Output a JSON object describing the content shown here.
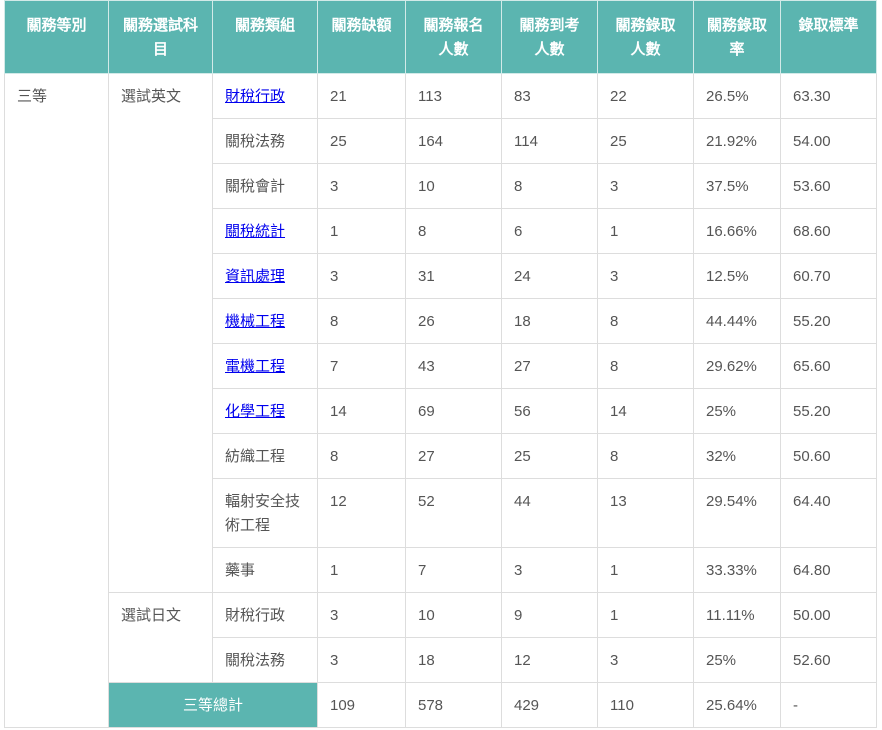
{
  "colors": {
    "header_bg": "#5bb5b0",
    "header_text": "#ffffff",
    "body_text": "#555555",
    "link": "#0000ee",
    "border": "#dddddd"
  },
  "table": {
    "headers": [
      "關務等別",
      "關務選試科目",
      "關務類組",
      "關務缺額",
      "關務報名人數",
      "關務到考人數",
      "關務錄取人數",
      "關務錄取率",
      "錄取標準"
    ],
    "level": "三等",
    "groups": [
      {
        "subject": "選試英文",
        "rows": [
          {
            "category": "財稅行政",
            "is_link": true,
            "vacancies": "21",
            "applicants": "113",
            "examinees": "83",
            "admitted": "22",
            "rate": "26.5%",
            "cutoff": "63.30"
          },
          {
            "category": "關稅法務",
            "is_link": false,
            "vacancies": "25",
            "applicants": "164",
            "examinees": "114",
            "admitted": "25",
            "rate": "21.92%",
            "cutoff": "54.00"
          },
          {
            "category": "關稅會計",
            "is_link": false,
            "vacancies": "3",
            "applicants": "10",
            "examinees": "8",
            "admitted": "3",
            "rate": "37.5%",
            "cutoff": "53.60"
          },
          {
            "category": "關稅統計",
            "is_link": true,
            "vacancies": "1",
            "applicants": "8",
            "examinees": "6",
            "admitted": "1",
            "rate": "16.66%",
            "cutoff": "68.60"
          },
          {
            "category": "資訊處理",
            "is_link": true,
            "vacancies": "3",
            "applicants": "31",
            "examinees": "24",
            "admitted": "3",
            "rate": "12.5%",
            "cutoff": "60.70"
          },
          {
            "category": "機械工程",
            "is_link": true,
            "vacancies": "8",
            "applicants": "26",
            "examinees": "18",
            "admitted": "8",
            "rate": "44.44%",
            "cutoff": "55.20"
          },
          {
            "category": "電機工程",
            "is_link": true,
            "vacancies": "7",
            "applicants": "43",
            "examinees": "27",
            "admitted": "8",
            "rate": "29.62%",
            "cutoff": "65.60"
          },
          {
            "category": "化學工程",
            "is_link": true,
            "vacancies": "14",
            "applicants": "69",
            "examinees": "56",
            "admitted": "14",
            "rate": "25%",
            "cutoff": "55.20"
          },
          {
            "category": "紡織工程",
            "is_link": false,
            "vacancies": "8",
            "applicants": "27",
            "examinees": "25",
            "admitted": "8",
            "rate": "32%",
            "cutoff": "50.60"
          },
          {
            "category": "輻射安全技術工程",
            "is_link": false,
            "vacancies": "12",
            "applicants": "52",
            "examinees": "44",
            "admitted": "13",
            "rate": "29.54%",
            "cutoff": "64.40"
          },
          {
            "category": "藥事",
            "is_link": false,
            "vacancies": "1",
            "applicants": "7",
            "examinees": "3",
            "admitted": "1",
            "rate": "33.33%",
            "cutoff": "64.80"
          }
        ]
      },
      {
        "subject": "選試日文",
        "rows": [
          {
            "category": "財稅行政",
            "is_link": false,
            "vacancies": "3",
            "applicants": "10",
            "examinees": "9",
            "admitted": "1",
            "rate": "11.11%",
            "cutoff": "50.00"
          },
          {
            "category": "關稅法務",
            "is_link": false,
            "vacancies": "3",
            "applicants": "18",
            "examinees": "12",
            "admitted": "3",
            "rate": "25%",
            "cutoff": "52.60"
          }
        ]
      }
    ],
    "total": {
      "label": "三等總計",
      "vacancies": "109",
      "applicants": "578",
      "examinees": "429",
      "admitted": "110",
      "rate": "25.64%",
      "cutoff": "-"
    }
  }
}
